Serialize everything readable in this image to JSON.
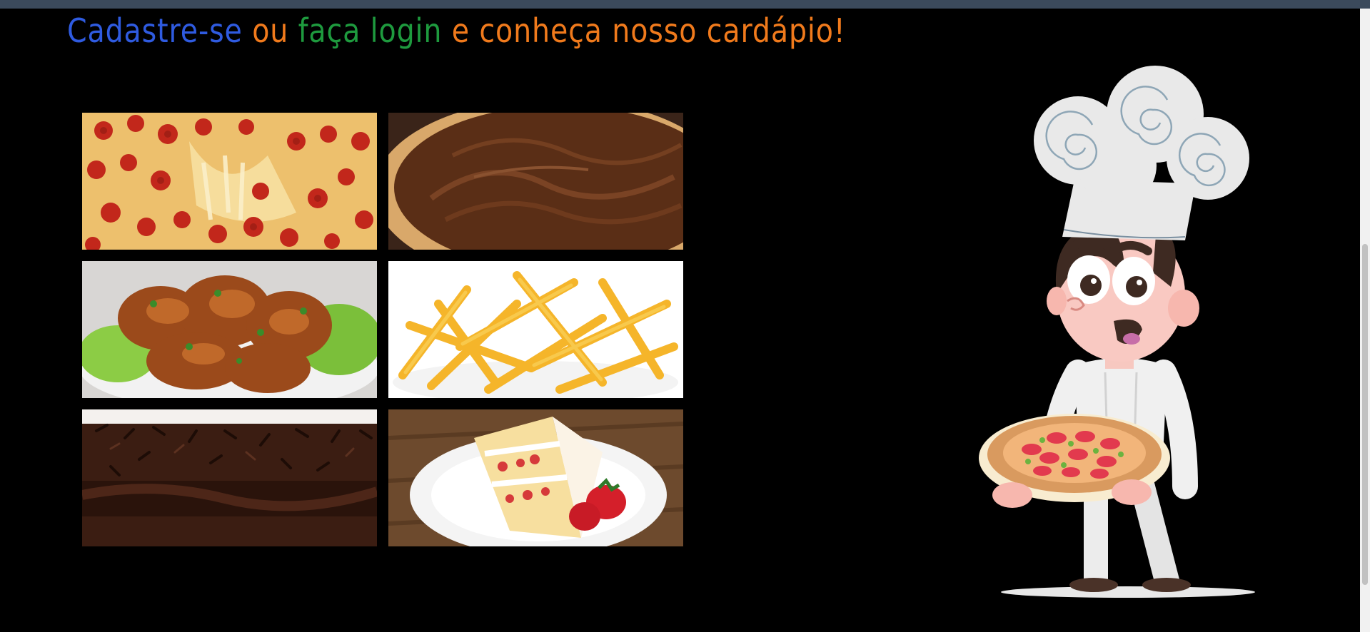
{
  "headline": {
    "part1": "Cadastre-se",
    "part2": " ou ",
    "part3": "faça login",
    "part4": " e conheça nosso cardápio!"
  },
  "colors": {
    "background": "#000000",
    "headline_blue": "#2f5be0",
    "headline_orange": "#f07a1c",
    "headline_green": "#1e9a3e"
  },
  "gallery": {
    "images": [
      "pepperoni-pizza-image",
      "chocolate-pizza-image",
      "fried-chicken-image",
      "french-fries-image",
      "chocolate-cake-image",
      "strawberry-cake-image"
    ]
  },
  "illustration": "chef-holding-pizza-illustration"
}
